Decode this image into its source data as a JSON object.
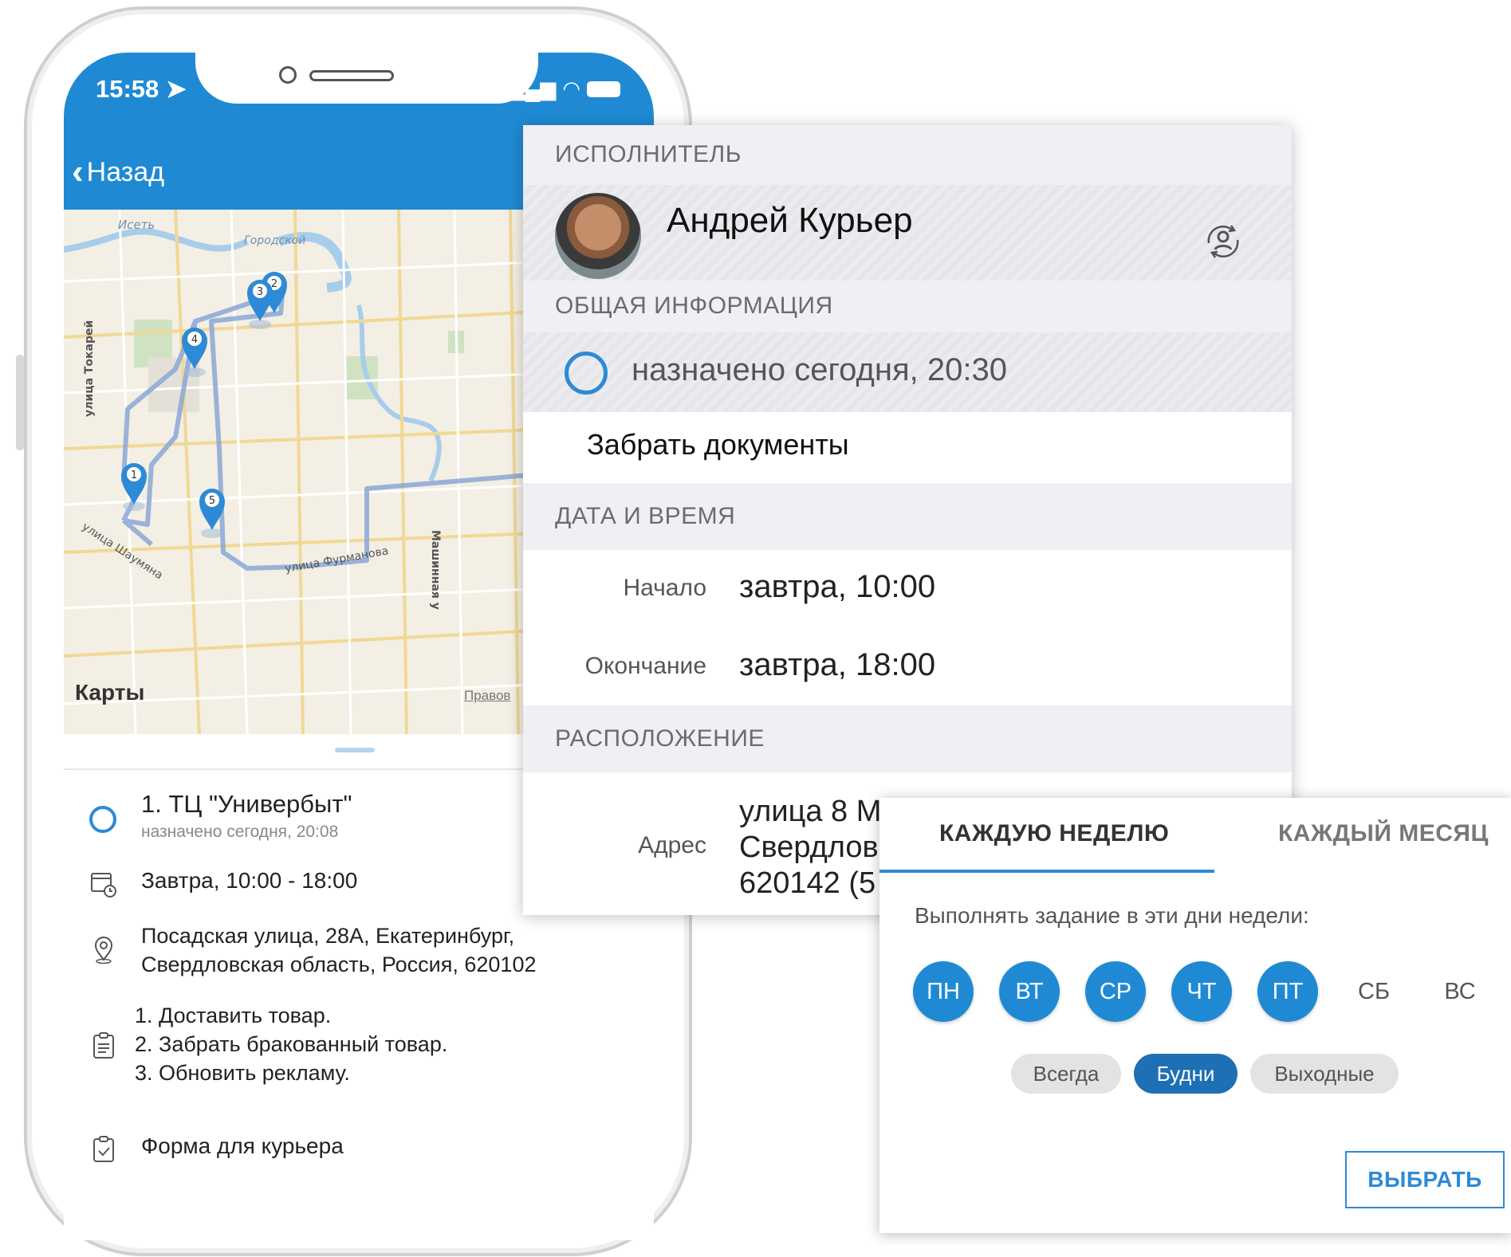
{
  "status_bar": {
    "time": "15:58"
  },
  "nav": {
    "back_label": "Назад"
  },
  "map": {
    "brand": "Карты",
    "legal": "Правов",
    "labels": [
      "Исеть",
      "Городской",
      "улица Токарей",
      "улица Шаумяна",
      "улица Фурманова",
      "Машинная у"
    ],
    "pins": [
      "1",
      "2",
      "3",
      "4",
      "5"
    ]
  },
  "task_item": {
    "title": "1. ТЦ \"Универбыт\"",
    "assigned": "назначено сегодня, 20:08",
    "datetime": "Завтра, 10:00 - 18:00",
    "address_line1": "Посадская улица, 28А, Екатеринбург,",
    "address_line2": "Свердловская область, Россия, 620102",
    "notes": [
      "1. Доставить товар.",
      "2. Забрать бракованный товар.",
      "3. Обновить рекламу."
    ],
    "form_label": "Форма для курьера"
  },
  "detail": {
    "executor_header": "ИСПОЛНИТЕЛЬ",
    "executor_name": "Андрей Курьер",
    "general_header": "ОБЩАЯ ИНФОРМАЦИЯ",
    "status": "назначено сегодня, 20:30",
    "task_title": "Забрать документы",
    "datetime_header": "ДАТА И ВРЕМЯ",
    "start_label": "Начало",
    "start_value": "завтра, 10:00",
    "end_label": "Окончание",
    "end_value": "завтра, 18:00",
    "location_header": "РАСПОЛОЖЕНИЕ",
    "address_label": "Адрес",
    "address_lines": [
      "улица 8 М",
      "Свердлов",
      "620142 (5"
    ]
  },
  "schedule": {
    "tab_weekly": "КАЖДУЮ НЕДЕЛЮ",
    "tab_monthly": "КАЖДЫЙ МЕСЯЦ",
    "hint": "Выполнять задание в эти дни недели:",
    "days": [
      {
        "label": "ПН",
        "selected": true
      },
      {
        "label": "ВТ",
        "selected": true
      },
      {
        "label": "СР",
        "selected": true
      },
      {
        "label": "ЧТ",
        "selected": true
      },
      {
        "label": "ПТ",
        "selected": true
      },
      {
        "label": "СБ",
        "selected": false
      },
      {
        "label": "ВС",
        "selected": false
      }
    ],
    "presets": [
      {
        "label": "Всегда",
        "selected": false
      },
      {
        "label": "Будни",
        "selected": true
      },
      {
        "label": "Выходные",
        "selected": false
      }
    ],
    "choose_label": "ВЫБРАТЬ"
  },
  "colors": {
    "accent": "#1f8ad3",
    "section_bg": "#efeff4"
  }
}
